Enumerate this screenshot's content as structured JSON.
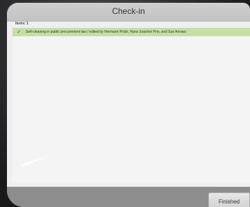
{
  "window": {
    "title": "Check-in"
  },
  "summary": {
    "items_count": "Items: 1"
  },
  "items": [
    {
      "icon": "checkmark-icon",
      "text": "Self-cleaning in public procurement law / edited by Hermann Pröbr, Hans-Joachim Prie, and Sue Arrowa"
    }
  ],
  "footer": {
    "finished_label": "Finished"
  },
  "colors": {
    "item_highlight": "#c4dfa6",
    "check": "#3c7a17",
    "footer": "#8d8d8d"
  }
}
